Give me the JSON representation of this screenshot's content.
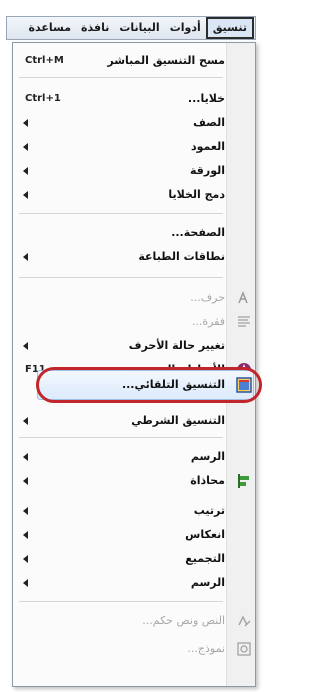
{
  "menubar": {
    "items": [
      {
        "label": "تنسيق",
        "active": true
      },
      {
        "label": "أدوات"
      },
      {
        "label": "البيانات"
      },
      {
        "label": "نافذة"
      },
      {
        "label": "مساعدة"
      }
    ]
  },
  "menu": {
    "items": [
      {
        "label": "مسح التنسيق المباشر",
        "shortcut": "Ctrl+M"
      },
      {
        "label": "خلايا...",
        "shortcut": "Ctrl+1"
      },
      {
        "label": "الصف",
        "submenu": true
      },
      {
        "label": "العمود",
        "submenu": true
      },
      {
        "label": "الورقة",
        "submenu": true
      },
      {
        "label": "دمج الخلايا",
        "submenu": true
      },
      {
        "label": "الصفحة..."
      },
      {
        "label": "نطاقات الطباعة",
        "submenu": true
      },
      {
        "label": "حرف...",
        "disabled": true,
        "icon": "font-icon"
      },
      {
        "label": "فقرة...",
        "disabled": true,
        "icon": "paragraph-icon"
      },
      {
        "label": "تغيير حالة الأحرف",
        "submenu": true
      },
      {
        "label": "الأنماط والتنسيق",
        "shortcut": "F11",
        "icon": "styles-icon"
      },
      {
        "label": "التنسيق التلقائي...",
        "icon": "autoformat-icon",
        "highlighted": true
      },
      {
        "label": "التنسيق الشرطي",
        "submenu": true
      },
      {
        "label": "الرسم",
        "submenu": true
      },
      {
        "label": "محاذاة",
        "submenu": true,
        "icon": "align-icon"
      },
      {
        "label": "ترتيب",
        "submenu": true
      },
      {
        "label": "انعكاس",
        "submenu": true
      },
      {
        "label": "التجميع",
        "submenu": true
      },
      {
        "label": "الرسم",
        "submenu": true
      },
      {
        "label": "النص ونص حكم...",
        "disabled": true,
        "icon": "fontwork-icon"
      },
      {
        "label": "نموذج...",
        "disabled": true,
        "icon": "form-icon"
      }
    ]
  },
  "colors": {
    "highlight_ring": "#c0262c",
    "selection": "#dceafb"
  }
}
